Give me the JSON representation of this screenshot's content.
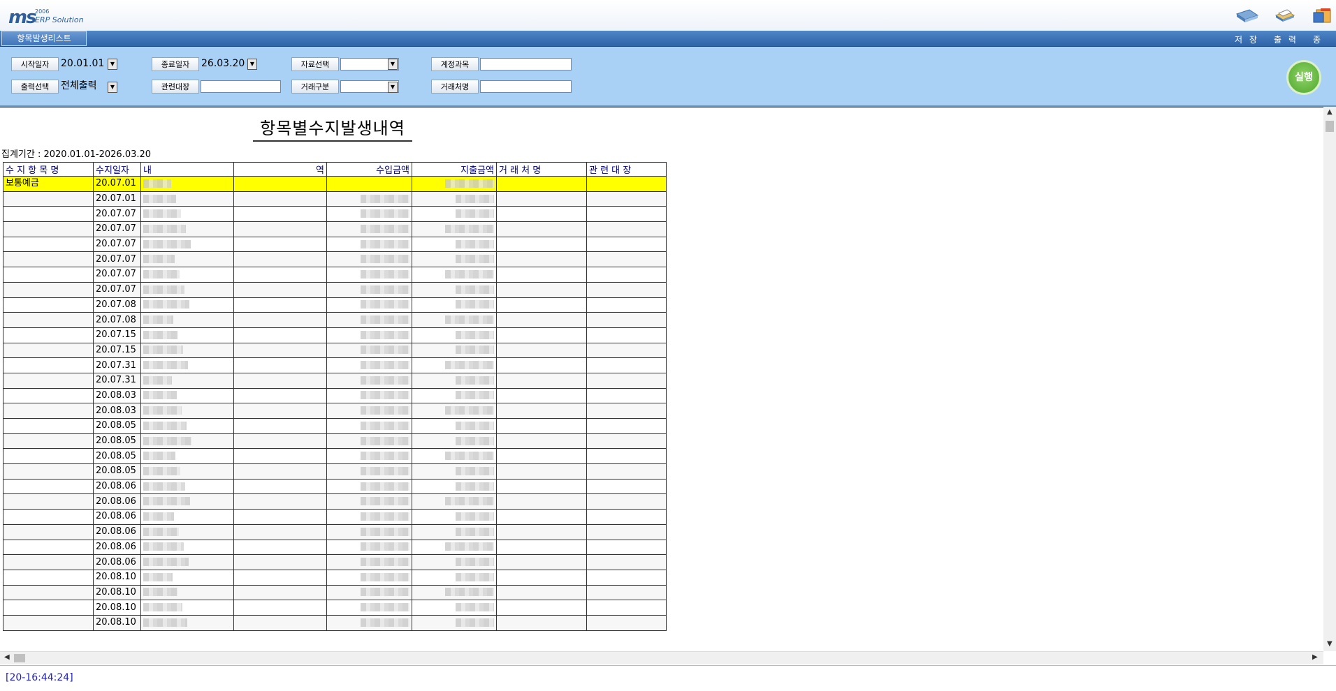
{
  "app": {
    "logo_main": "ms",
    "logo_year": "2006",
    "logo_sub": "ERP Solution",
    "active_tab": "항목발생리스트",
    "menu": [
      {
        "name": "save",
        "label": "저 장",
        "icon": "save-icon"
      },
      {
        "name": "print",
        "label": "출 력",
        "icon": "print-icon"
      },
      {
        "name": "exit",
        "label": "종 료",
        "icon": "exit-icon"
      }
    ]
  },
  "filters": {
    "start_date_label": "시작일자",
    "start_date_value": "20.01.01",
    "end_date_label": "종료일자",
    "end_date_value": "26.03.20",
    "data_select_label": "자료선택",
    "data_select_value": "",
    "account_label": "계정과목",
    "account_value": "",
    "output_select_label": "출력선택",
    "output_select_value": "전체출력",
    "ledger_label": "관련대장",
    "ledger_value": "",
    "trade_type_label": "거래구분",
    "trade_type_value": "",
    "client_label": "거래처명",
    "client_value": "",
    "run_label": "실행"
  },
  "report": {
    "title": "항목별수지발생내역",
    "period": "집계기간 : 2020.01.01-2026.03.20",
    "columns": [
      "수 지 항 목 명",
      "수지일자",
      "내",
      "역",
      "수입금액",
      "지출금액",
      "거 래 처 명",
      "관 련 대 장"
    ],
    "first_item": "보통예금",
    "rows": [
      {
        "date": "20.07.01"
      },
      {
        "date": "20.07.01"
      },
      {
        "date": "20.07.07"
      },
      {
        "date": "20.07.07"
      },
      {
        "date": "20.07.07"
      },
      {
        "date": "20.07.07"
      },
      {
        "date": "20.07.07"
      },
      {
        "date": "20.07.07"
      },
      {
        "date": "20.07.08"
      },
      {
        "date": "20.07.08"
      },
      {
        "date": "20.07.15"
      },
      {
        "date": "20.07.15"
      },
      {
        "date": "20.07.31"
      },
      {
        "date": "20.07.31"
      },
      {
        "date": "20.08.03"
      },
      {
        "date": "20.08.03"
      },
      {
        "date": "20.08.05"
      },
      {
        "date": "20.08.05"
      },
      {
        "date": "20.08.05"
      },
      {
        "date": "20.08.05"
      },
      {
        "date": "20.08.06"
      },
      {
        "date": "20.08.06"
      },
      {
        "date": "20.08.06"
      },
      {
        "date": "20.08.06"
      },
      {
        "date": "20.08.06"
      },
      {
        "date": "20.08.06"
      },
      {
        "date": "20.08.10"
      },
      {
        "date": "20.08.10"
      },
      {
        "date": "20.08.10"
      },
      {
        "date": "20.08.10"
      }
    ]
  },
  "status": {
    "text": "[20-16:44:24]"
  },
  "colors": {
    "panel": "#a9d0f5",
    "highlight_row": "#ffff00",
    "header_text": "#000080",
    "tab_blue": "#3f75ba"
  }
}
